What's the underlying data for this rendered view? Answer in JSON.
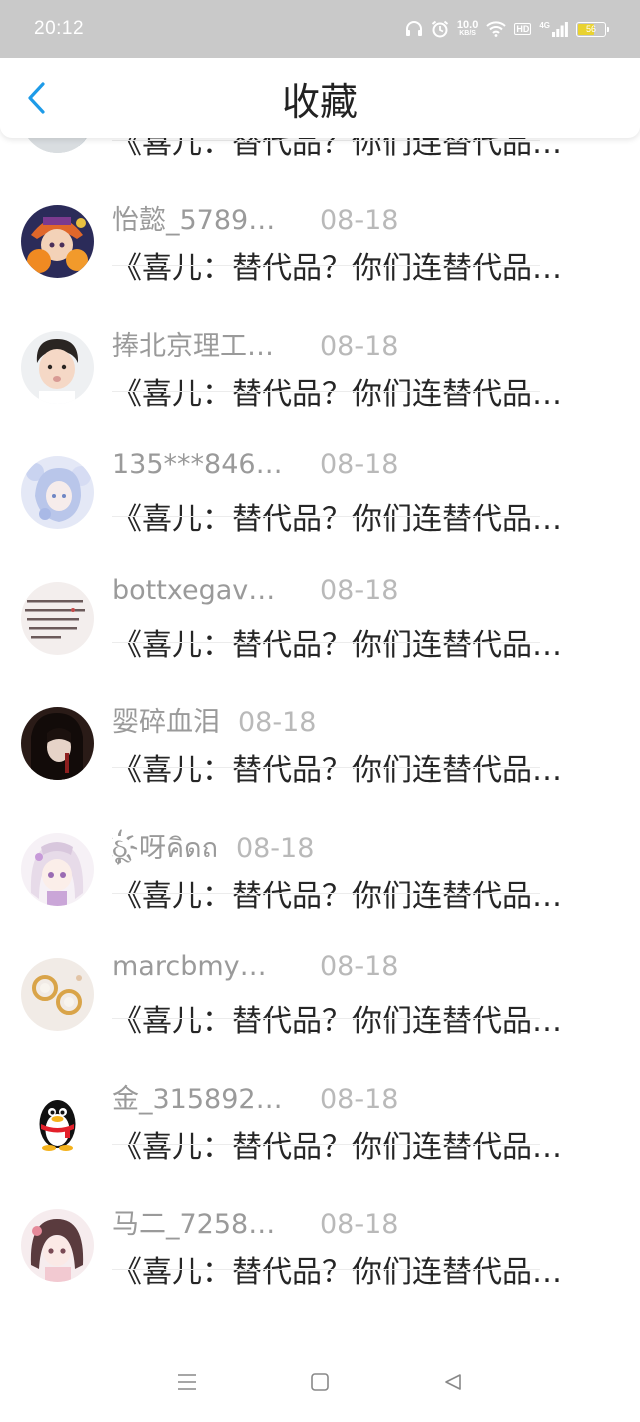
{
  "status_bar": {
    "time": "20:12",
    "net_speed_value": "10.0",
    "net_speed_unit": "KB/S",
    "hd_label": "HD",
    "network_label": "4G",
    "battery_text": "56",
    "battery_level_percent": 56,
    "battery_color": "#e9d230"
  },
  "header": {
    "title": "收藏",
    "accent_color": "#1e9be8"
  },
  "items": [
    {
      "user": "",
      "date": "",
      "text": "《喜儿：替代品？你们连替代品…",
      "avatar_icon": "avatar-photo-child"
    },
    {
      "user": "怡懿_5789…",
      "date": "08-18",
      "text": "《喜儿：替代品？你们连替代品…",
      "avatar_icon": "avatar-halloween"
    },
    {
      "user": "捧北京理工…",
      "date": "08-18",
      "text": "《喜儿：替代品？你们连替代品…",
      "avatar_icon": "avatar-boy"
    },
    {
      "user": "135***846…",
      "date": "08-18",
      "text": "《喜儿：替代品？你们连替代品…",
      "avatar_icon": "avatar-anime-blue"
    },
    {
      "user": "bottxegav…",
      "date": "08-18",
      "text": "《喜儿：替代品？你们连替代品…",
      "avatar_icon": "avatar-handwriting"
    },
    {
      "user": "婴碎血泪",
      "date": "08-18",
      "text": "《喜儿：替代品？你们连替代品…",
      "avatar_icon": "avatar-dark-art"
    },
    {
      "user": "ઠૂ҉呀คิดถ",
      "date": "08-18",
      "text": "《喜儿：替代品？你们连替代品…",
      "avatar_icon": "avatar-anime-girl"
    },
    {
      "user": "marcbmy…",
      "date": "08-18",
      "text": "《喜儿：替代品？你们连替代品…",
      "avatar_icon": "avatar-earrings"
    },
    {
      "user": "金_315892…",
      "date": "08-18",
      "text": "《喜儿：替代品？你们连替代品…",
      "avatar_icon": "avatar-qq-penguin"
    },
    {
      "user": "马二_7258…",
      "date": "08-18",
      "text": "《喜儿：替代品？你们连替代品…",
      "avatar_icon": "avatar-anime-pink"
    }
  ],
  "nav_bar": {
    "menu_icon": "menu-icon",
    "home_icon": "home-square-icon",
    "back_icon": "back-triangle-icon"
  }
}
